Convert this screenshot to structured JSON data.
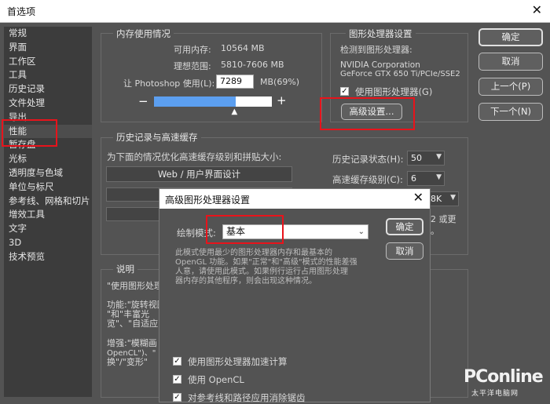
{
  "window": {
    "title": "首选项"
  },
  "sidebar": {
    "items": [
      "常规",
      "界面",
      "工作区",
      "工具",
      "历史记录",
      "文件处理",
      "导出",
      "性能",
      "暂存盘",
      "光标",
      "透明度与色域",
      "单位与标尺",
      "参考线、网格和切片",
      "增效工具",
      "文字",
      "3D",
      "技术预览"
    ]
  },
  "memory": {
    "title": "内存使用情况",
    "available_label": "可用内存:",
    "available_value": "10564 MB",
    "ideal_label": "理想范围:",
    "ideal_value": "5810-7606 MB",
    "let_label": "让 Photoshop 使用(L):",
    "let_value": "7289",
    "let_suffix": "MB(69%)",
    "minus": "−",
    "plus": "+",
    "slider_fraction": 0.69
  },
  "gpu": {
    "title": "图形处理器设置",
    "detected_label": "检测到图形处理器:",
    "vendor": "NVIDIA Corporation",
    "model": "GeForce GTX 650 Ti/PCIe/SSE2",
    "use_gpu_label": "使用图形处理器(G)",
    "advanced_button": "高级设置..."
  },
  "history": {
    "title": "历史记录与高速缓存",
    "optimize_label": "为下面的情况优化高速缓存级别和拼贴大小:",
    "web_option": "Web / 用户界面设计",
    "states_label": "历史记录状态(H):",
    "states_value": "50",
    "cache_label": "高速缓存级别(C):",
    "cache_value": "6",
    "tile_fragment": "8K",
    "note_fragment": "2 或更",
    "note_fragment2": "。"
  },
  "description": {
    "title": "说明",
    "lines": [
      "\"使用图形处理",
      "功能:\"旋转视图",
      "\"和\"丰富光",
      "览\"、\"自适应",
      "增强:\"模糊画",
      "OpenCL\")、\"",
      "换\"/\"变形\""
    ]
  },
  "buttons": {
    "ok": "确定",
    "cancel": "取消",
    "prev": "上一个(P)",
    "next": "下一个(N)"
  },
  "advanced_dialog": {
    "title": "高级图形处理器设置",
    "mode_label": "绘制模式:",
    "mode_value": "基本",
    "ok": "确定",
    "cancel": "取消",
    "desc_lines": [
      "此模式使用最少的图形处理器内存和最基本的",
      "OpenGL 功能。如果\"正常\"和\"高级\"模式的性能差强",
      "人意，请使用此模式。如果例行运行占用图形处理",
      "器内存的其他程序，则会出现这种情况。"
    ],
    "checkboxes": [
      "使用图形处理器加速计算",
      "使用 OpenCL",
      "对参考线和路径应用消除锯齿"
    ]
  },
  "watermark": {
    "brand": "PConline",
    "sub": "太平洋电脑网"
  },
  "colors": {
    "slider_fill": "#5c9ff0",
    "highlight": "#e8131b"
  }
}
